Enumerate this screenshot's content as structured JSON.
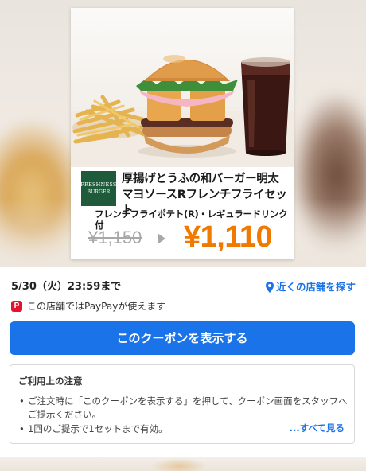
{
  "coupon": {
    "logo_line1": "PRESHNESS",
    "logo_line2": "BURGER",
    "product_name": "厚揚げとうふの和バーガー明太マヨソースRフレンチフライセット",
    "product_sub": "フレンチフライポテト(R)・レギュラードリンク付",
    "old_price": "¥1,150",
    "new_price": "¥1,110"
  },
  "info": {
    "deadline": "5/30（火）23:59まで",
    "find_stores_label": "近くの店舗を探す",
    "paypay_icon_glyph": "P",
    "paypay_text": "この店舗ではPayPayが使えます"
  },
  "actions": {
    "show_coupon_label": "このクーポンを表示する"
  },
  "notice": {
    "title": "ご利用上の注意",
    "items": [
      "ご注文時に「このクーポンを表示する」を押して、クーポン画面をスタッフへご提示ください。",
      "1回のご提示で1セットまで有効。"
    ],
    "see_all_label": "...すべて見る"
  },
  "colors": {
    "accent_blue": "#1a73e8",
    "price_orange": "#f07a00",
    "paypay_red": "#e8112d",
    "brand_green": "#1f5a3a"
  }
}
